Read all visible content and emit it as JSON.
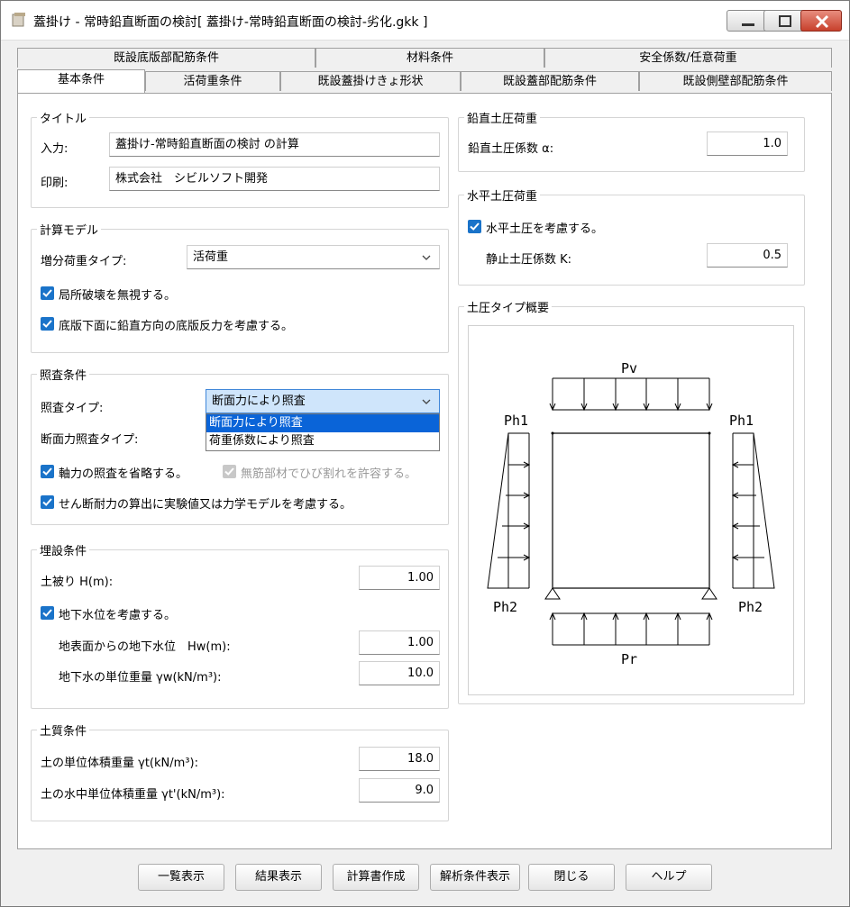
{
  "window": {
    "title": "蓋掛け - 常時鉛直断面の検討[ 蓋掛け-常時鉛直断面の検討-劣化.gkk ]"
  },
  "tabs": {
    "row1": [
      "既設底版部配筋条件",
      "材料条件",
      "安全係数/任意荷重"
    ],
    "row2": [
      "基本条件",
      "活荷重条件",
      "既設蓋掛けきょ形状",
      "既設蓋部配筋条件",
      "既設側壁部配筋条件"
    ],
    "active": "基本条件"
  },
  "title_group": {
    "title": "タイトル",
    "input_label": "入力:",
    "input_value": "蓋掛け-常時鉛直断面の検討 の計算",
    "print_label": "印刷:",
    "print_value": "株式会社　シビルソフト開発"
  },
  "calc_model": {
    "title": "計算モデル",
    "load_type_label": "増分荷重タイプ:",
    "load_type_value": "活荷重",
    "ignore_local_failure": "局所破壊を無視する。",
    "consider_base_reaction": "底版下面に鉛直方向の底版反力を考慮する。"
  },
  "check_conditions": {
    "title": "照査条件",
    "check_type_label": "照査タイプ:",
    "check_type_value": "断面力により照査",
    "options": [
      "断面力により照査",
      "荷重係数により照査"
    ],
    "section_force_type_label": "断面力照査タイプ:",
    "omit_axial": "軸力の照査を省略する。",
    "allow_crack": "無筋部材でひび割れを許容する。",
    "shear_model": "せん断耐力の算出に実験値又は力学モデルを考慮する。"
  },
  "burial": {
    "title": "埋設条件",
    "cover_label": "土被り H(m):",
    "cover_value": "1.00",
    "consider_gw": "地下水位を考慮する。",
    "gw_level_label": "地表面からの地下水位　Hw(m):",
    "gw_level_value": "1.00",
    "gw_weight_label": "地下水の単位重量 γw(kN/m³):",
    "gw_weight_value": "10.0"
  },
  "soil": {
    "title": "土質条件",
    "unit_weight_label": "土の単位体積重量 γt(kN/m³):",
    "unit_weight_value": "18.0",
    "sub_weight_label": "土の水中単位体積重量 γt'(kN/m³):",
    "sub_weight_value": "9.0"
  },
  "vertical_earth": {
    "title": "鉛直土圧荷重",
    "coef_label": "鉛直土圧係数 α:",
    "coef_value": "1.0"
  },
  "horizontal_earth": {
    "title": "水平土圧荷重",
    "consider": "水平土圧を考慮する。",
    "coef_label": "静止土圧係数 K:",
    "coef_value": "0.5"
  },
  "diagram": {
    "title": "土圧タイプ概要",
    "pv": "Pv",
    "ph1": "Ph1",
    "ph2": "Ph2",
    "pr": "Pr"
  },
  "buttons": [
    "一覧表示",
    "結果表示",
    "計算書作成",
    "解析条件表示",
    "閉じる",
    "ヘルプ"
  ]
}
